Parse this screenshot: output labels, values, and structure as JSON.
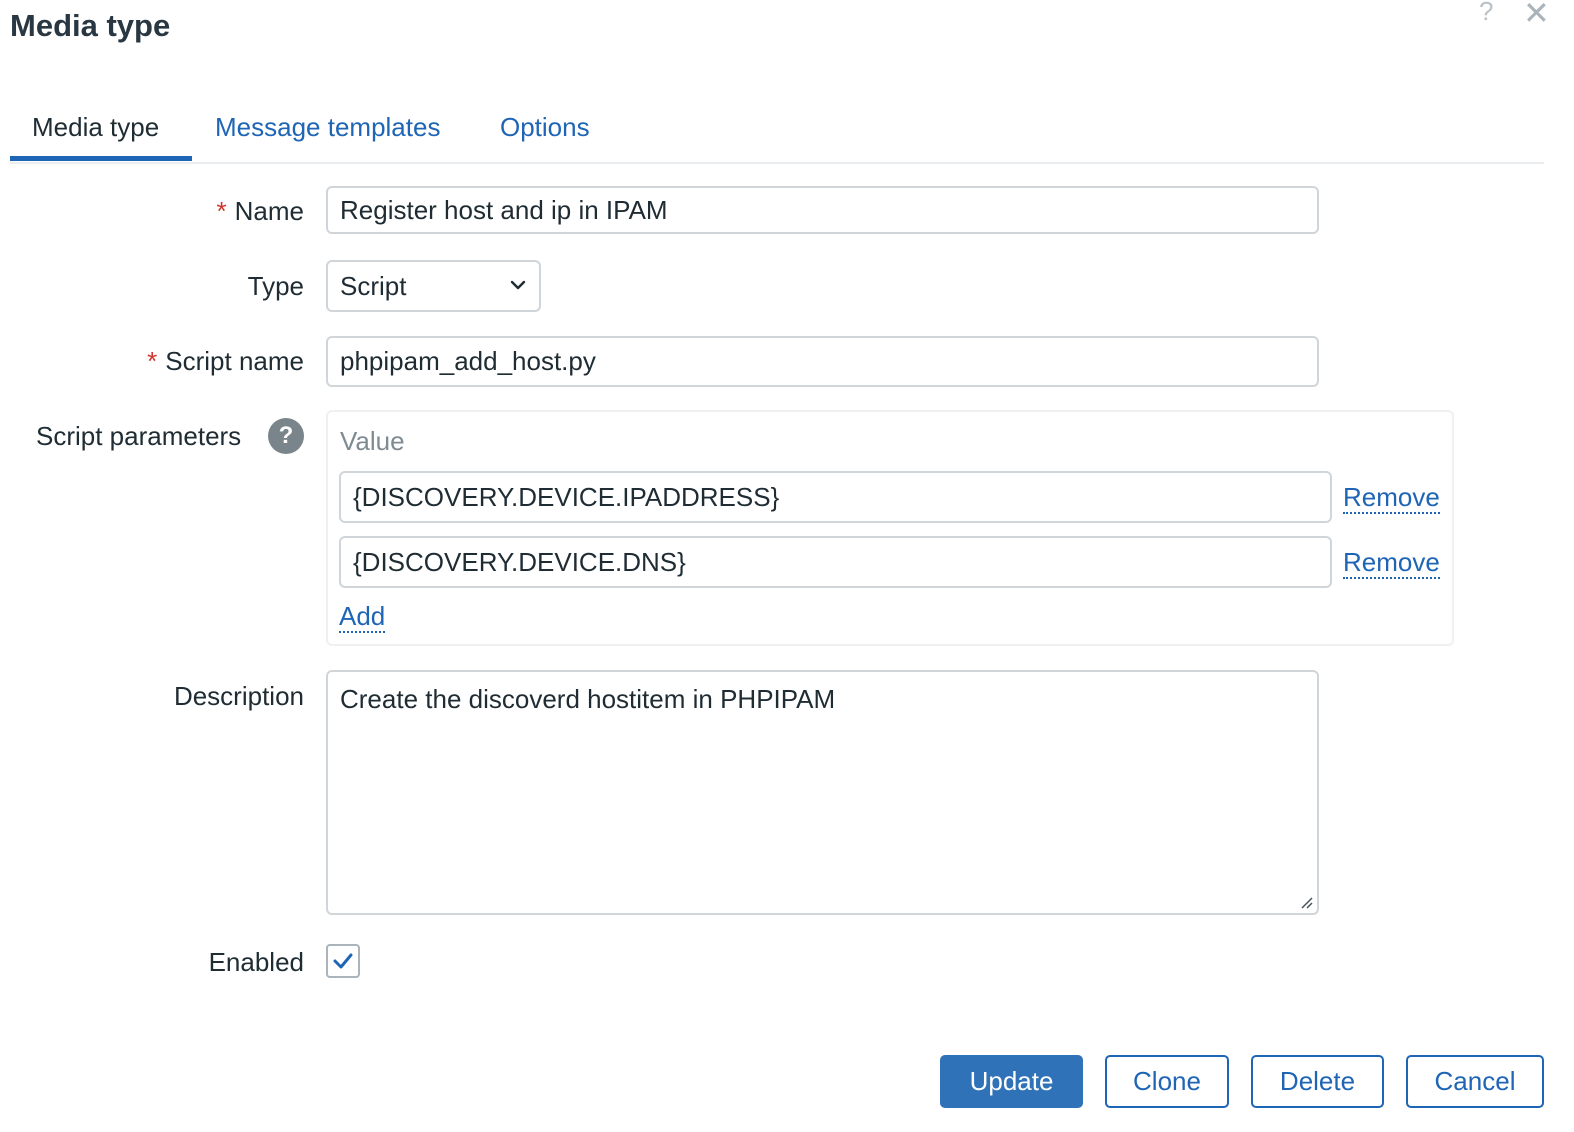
{
  "dialog": {
    "title": "Media type",
    "help_glyph": "?",
    "close_glyph": "✕"
  },
  "tabs": [
    {
      "label": "Media type",
      "active": true
    },
    {
      "label": "Message templates",
      "active": false
    },
    {
      "label": "Options",
      "active": false
    }
  ],
  "form": {
    "name": {
      "label": "Name",
      "required_mark": "*",
      "value": "Register host and ip in IPAM"
    },
    "type": {
      "label": "Type",
      "selected": "Script"
    },
    "script_name": {
      "label": "Script name",
      "required_mark": "*",
      "value": "phpipam_add_host.py"
    },
    "script_parameters": {
      "label": "Script parameters",
      "help_glyph": "?",
      "column_header": "Value",
      "rows": [
        {
          "value": "{DISCOVERY.DEVICE.IPADDRESS}",
          "remove_label": "Remove"
        },
        {
          "value": "{DISCOVERY.DEVICE.DNS}",
          "remove_label": "Remove"
        }
      ],
      "add_label": "Add"
    },
    "description": {
      "label": "Description",
      "value": "Create the discoverd hostitem in PHPIPAM"
    },
    "enabled": {
      "label": "Enabled",
      "checked": true
    }
  },
  "buttons": {
    "update": "Update",
    "clone": "Clone",
    "delete": "Delete",
    "cancel": "Cancel"
  },
  "colors": {
    "accent": "#1f65b5",
    "primary_button": "#2f72b8",
    "required": "#d0342c"
  },
  "icons": {
    "help": "help-icon",
    "close": "close-icon",
    "chevron": "chevron-down-icon",
    "check": "check-icon"
  }
}
